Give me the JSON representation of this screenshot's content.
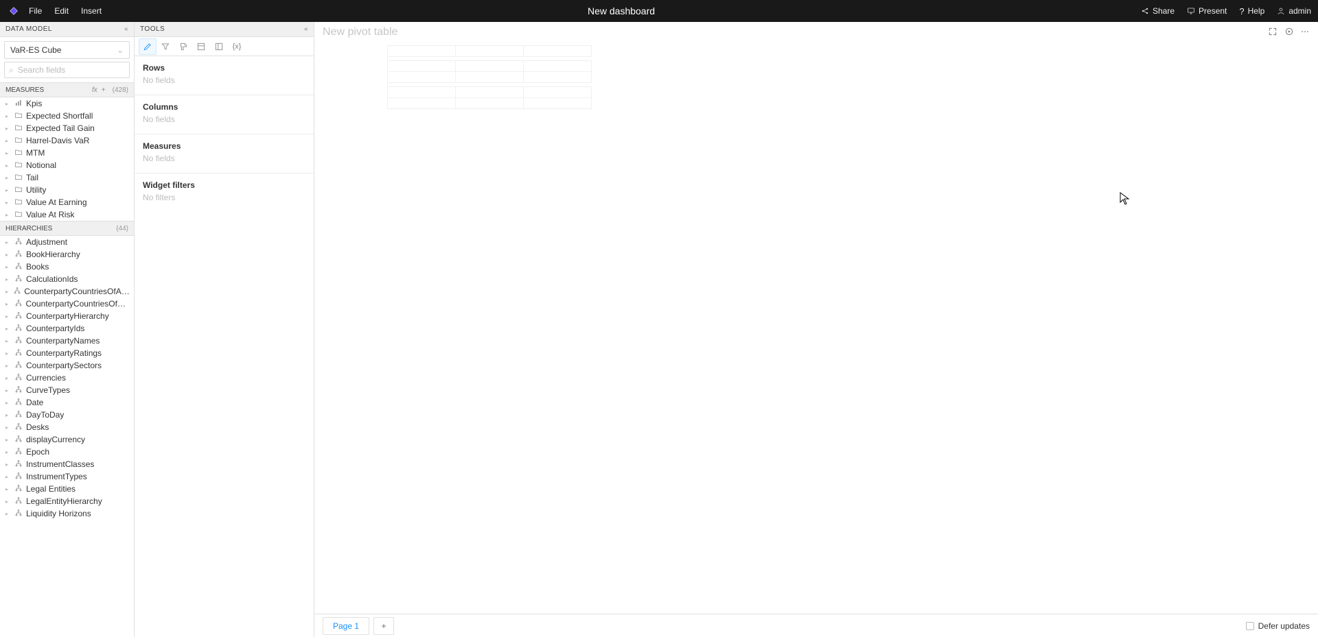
{
  "topbar": {
    "title": "New dashboard",
    "menu_file": "File",
    "menu_edit": "Edit",
    "menu_insert": "Insert",
    "share": "Share",
    "present": "Present",
    "help": "Help",
    "user": "admin"
  },
  "datamodel": {
    "header": "DATA MODEL",
    "cube": "VaR-ES Cube",
    "search_placeholder": "Search fields"
  },
  "measures": {
    "header": "MEASURES",
    "count": "(428)",
    "items": [
      {
        "label": "Kpis",
        "icon": "kpi",
        "expandable": true
      },
      {
        "label": "Expected Shortfall",
        "icon": "folder",
        "expandable": true
      },
      {
        "label": "Expected Tail Gain",
        "icon": "folder",
        "expandable": true
      },
      {
        "label": "Harrel-Davis VaR",
        "icon": "folder",
        "expandable": true
      },
      {
        "label": "MTM",
        "icon": "folder",
        "expandable": true
      },
      {
        "label": "Notional",
        "icon": "folder",
        "expandable": true
      },
      {
        "label": "Tail",
        "icon": "folder",
        "expandable": true
      },
      {
        "label": "Utility",
        "icon": "folder",
        "expandable": true
      },
      {
        "label": "Value At Earning",
        "icon": "folder",
        "expandable": true
      },
      {
        "label": "Value At Risk",
        "icon": "folder",
        "expandable": true
      }
    ]
  },
  "hierarchies": {
    "header": "HIERARCHIES",
    "count": "(44)",
    "items": [
      {
        "label": "Adjustment",
        "expandable": true
      },
      {
        "label": "BookHierarchy",
        "expandable": true
      },
      {
        "label": "Books",
        "expandable": true
      },
      {
        "label": "CalculationIds",
        "expandable": true
      },
      {
        "label": "CounterpartyCountriesOfAddress",
        "expandable": true
      },
      {
        "label": "CounterpartyCountriesOfRisk",
        "expandable": true
      },
      {
        "label": "CounterpartyHierarchy",
        "expandable": true
      },
      {
        "label": "CounterpartyIds",
        "expandable": true
      },
      {
        "label": "CounterpartyNames",
        "expandable": true
      },
      {
        "label": "CounterpartyRatings",
        "expandable": true
      },
      {
        "label": "CounterpartySectors",
        "expandable": true
      },
      {
        "label": "Currencies",
        "expandable": true
      },
      {
        "label": "CurveTypes",
        "expandable": true
      },
      {
        "label": "Date",
        "expandable": true
      },
      {
        "label": "DayToDay",
        "expandable": true
      },
      {
        "label": "Desks",
        "expandable": true
      },
      {
        "label": "displayCurrency",
        "expandable": true
      },
      {
        "label": "Epoch",
        "expandable": true
      },
      {
        "label": "InstrumentClasses",
        "expandable": true
      },
      {
        "label": "InstrumentTypes",
        "expandable": true
      },
      {
        "label": "Legal Entities",
        "expandable": true
      },
      {
        "label": "LegalEntityHierarchy",
        "expandable": true
      },
      {
        "label": "Liquidity Horizons",
        "expandable": true
      }
    ]
  },
  "tools": {
    "header": "TOOLS",
    "sections": {
      "rows": {
        "title": "Rows",
        "empty": "No fields"
      },
      "columns": {
        "title": "Columns",
        "empty": "No fields"
      },
      "measures": {
        "title": "Measures",
        "empty": "No fields"
      },
      "filters": {
        "title": "Widget filters",
        "empty": "No filters"
      }
    }
  },
  "canvas": {
    "title": "New pivot table"
  },
  "footer": {
    "page": "Page 1",
    "defer": "Defer updates"
  }
}
